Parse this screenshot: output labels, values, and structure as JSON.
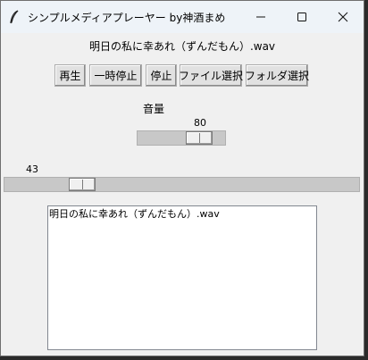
{
  "window": {
    "title": "シンプルメディアプレーヤー by神酒まめ"
  },
  "now_playing": "明日の私に幸あれ（ずんだもん）.wav",
  "buttons": {
    "play": "再生",
    "pause": "一時停止",
    "stop": "停止",
    "select_file": "ファイル選択",
    "select_folder": "フォルダ選択"
  },
  "volume": {
    "label": "音量",
    "value": "80",
    "value_num": 80
  },
  "position": {
    "value": "43",
    "value_num": 43
  },
  "playlist": {
    "items": [
      "明日の私に幸あれ（ずんだもん）.wav"
    ]
  },
  "icons": {
    "app": "feather-icon",
    "minimize": "minimize-icon",
    "maximize": "maximize-icon",
    "close": "close-icon"
  }
}
